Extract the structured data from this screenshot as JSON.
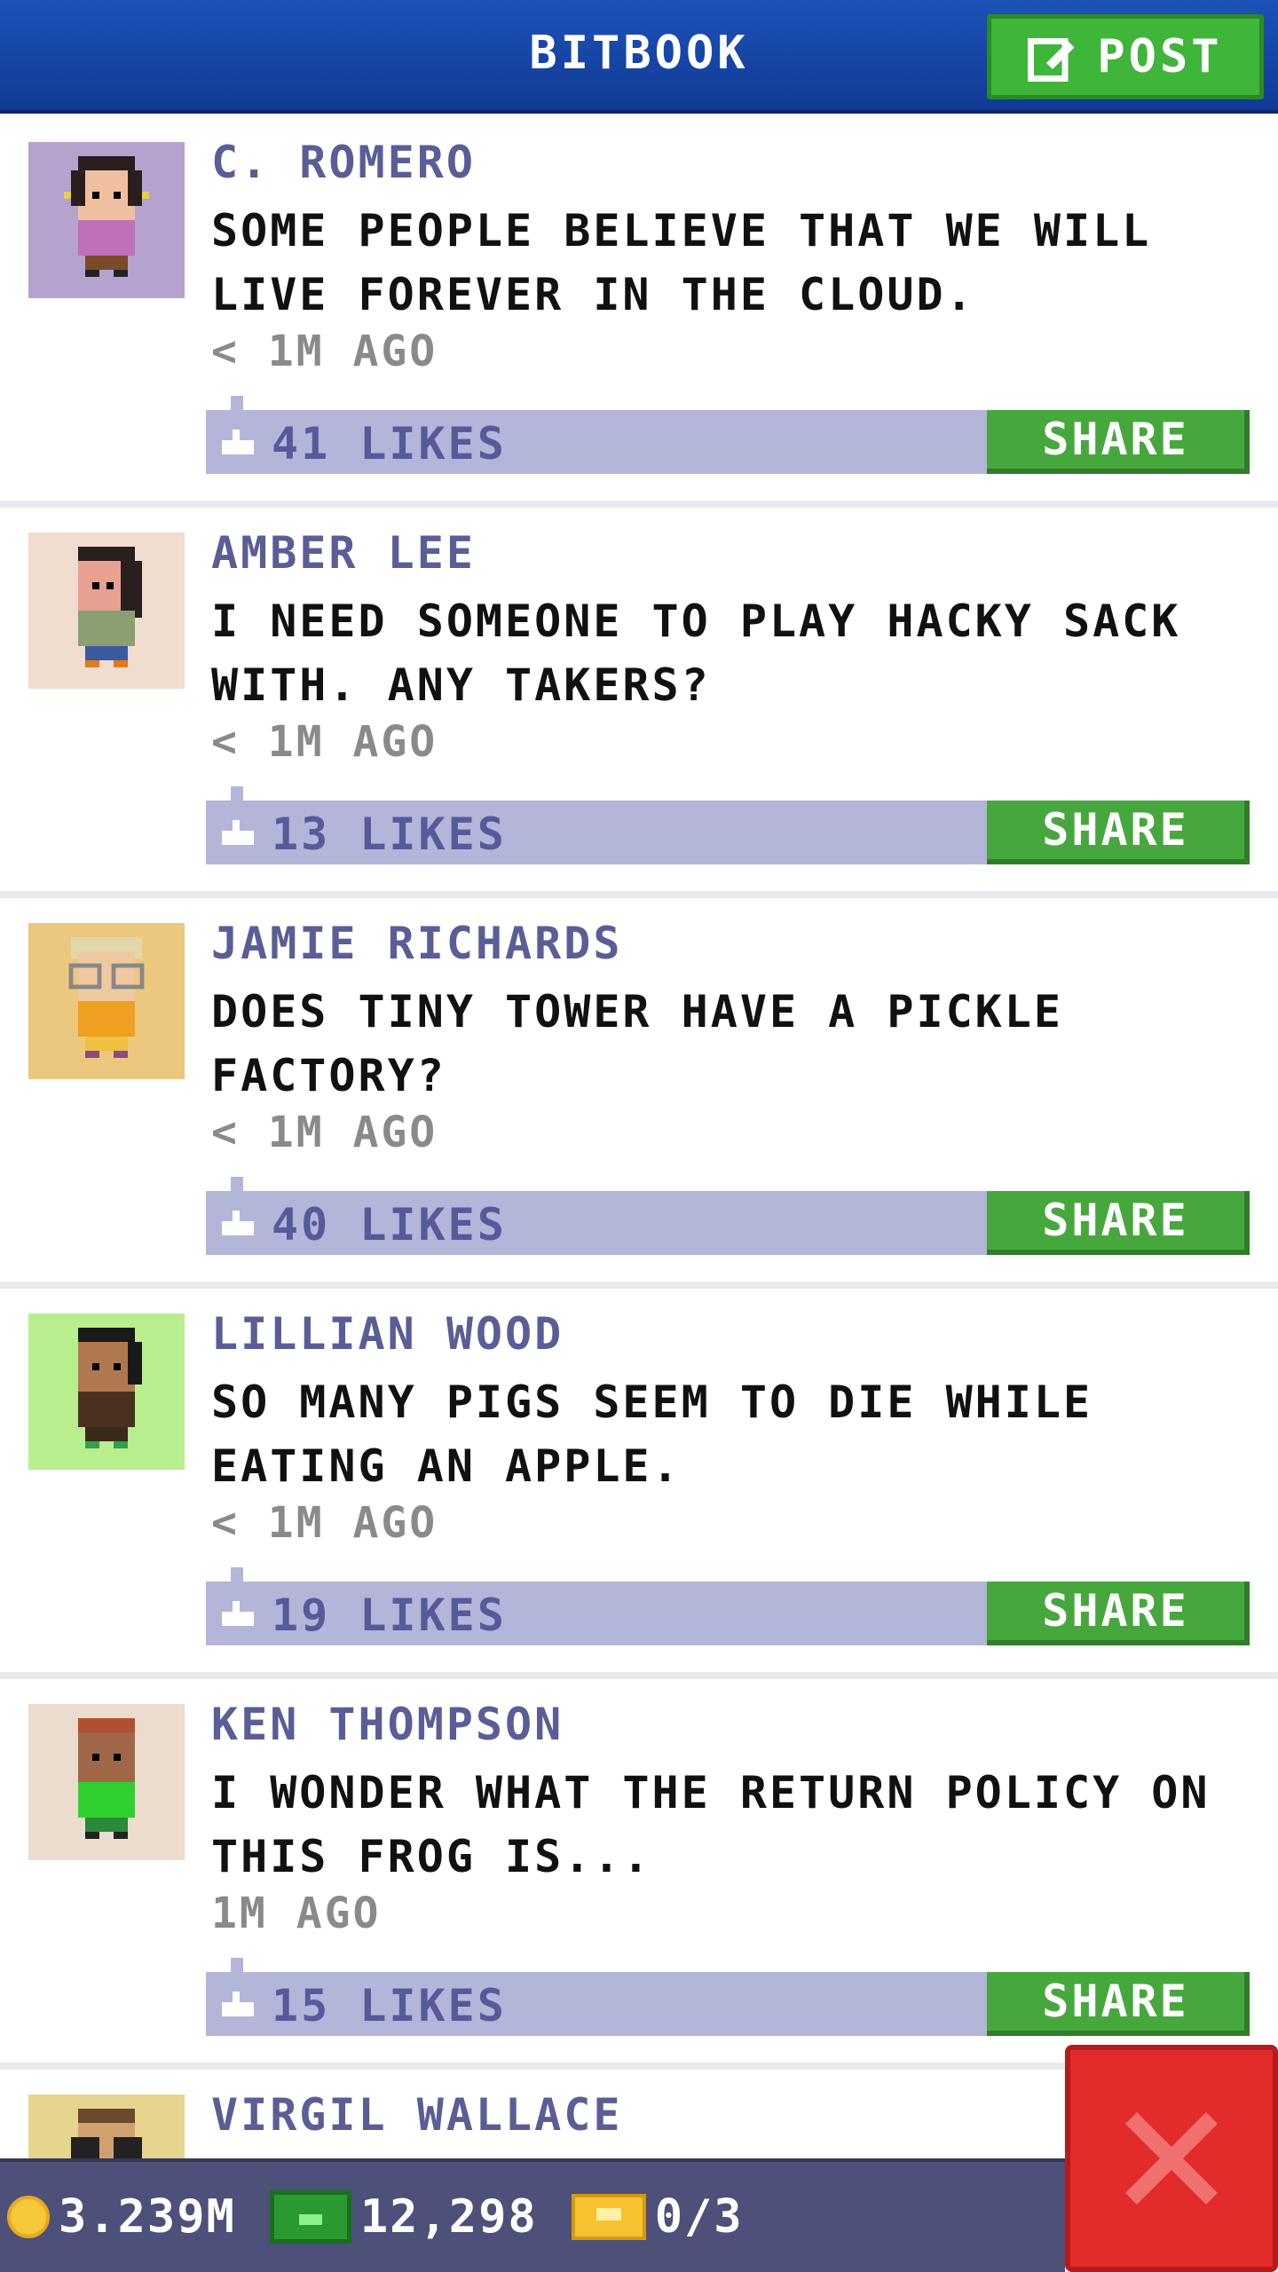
{
  "header": {
    "title": "BITBOOK",
    "post_label": "POST"
  },
  "posts": [
    {
      "name": "C. ROMERO",
      "text": "SOME PEOPLE BELIEVE THAT WE WILL LIVE FOREVER IN THE CLOUD.",
      "time": "< 1M AGO",
      "likes": "41 LIKES",
      "share_label": "SHARE",
      "avatar_bg": "#b6a2cf"
    },
    {
      "name": "AMBER LEE",
      "text": "I NEED SOMEONE TO PLAY HACKY SACK WITH. ANY TAKERS?",
      "time": "< 1M AGO",
      "likes": "13 LIKES",
      "share_label": "SHARE",
      "avatar_bg": "#f1dcd0"
    },
    {
      "name": "JAMIE RICHARDS",
      "text": "DOES TINY TOWER HAVE A PICKLE FACTORY?",
      "time": "< 1M AGO",
      "likes": "40 LIKES",
      "share_label": "SHARE",
      "avatar_bg": "#ecc77e"
    },
    {
      "name": "LILLIAN WOOD",
      "text": "SO MANY PIGS SEEM TO DIE WHILE EATING AN APPLE.",
      "time": "< 1M AGO",
      "likes": "19 LIKES",
      "share_label": "SHARE",
      "avatar_bg": "#b9ee8f"
    },
    {
      "name": "KEN THOMPSON",
      "text": "I WONDER WHAT THE RETURN POLICY ON THIS FROG IS...",
      "time": "1M AGO",
      "likes": "15 LIKES",
      "share_label": "SHARE",
      "avatar_bg": "#ecdccd"
    }
  ],
  "partial_post": {
    "name": "VIRGIL WALLACE",
    "avatar_bg": "#e6d58e"
  },
  "status_bar": {
    "coins": "3.239M",
    "bux": "12,298",
    "tickets": "0/3"
  },
  "colors": {
    "header": "#1a4fb4",
    "post_button": "#3fb53a",
    "share_button": "#46a83c",
    "like_bar": "#b3b5d9",
    "close_button": "#e32b2b"
  }
}
